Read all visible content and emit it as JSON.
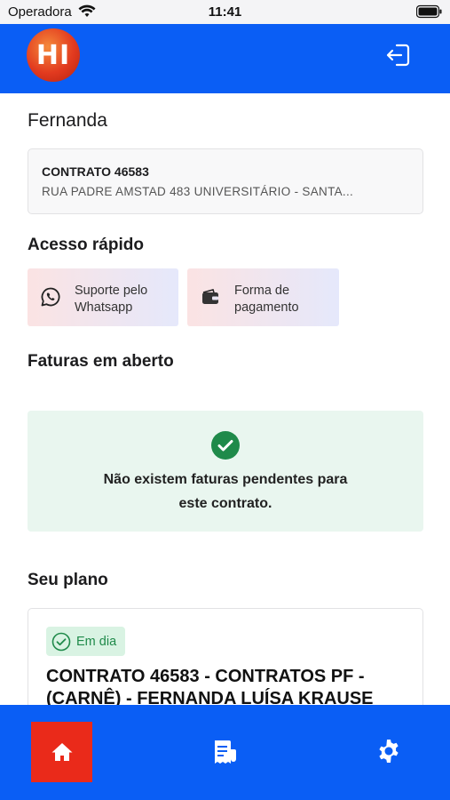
{
  "status_bar": {
    "carrier": "Operadora",
    "time": "11:41"
  },
  "header": {
    "logo_text": "HI",
    "logout_icon": "logout-icon"
  },
  "user": {
    "name": "Fernanda"
  },
  "contract": {
    "title": "CONTRATO 46583",
    "address": "RUA PADRE AMSTAD 483 UNIVERSITÁRIO - SANTA..."
  },
  "quick_access": {
    "title": "Acesso rápido",
    "items": [
      {
        "label": "Suporte pelo Whatsapp",
        "icon": "whatsapp-icon"
      },
      {
        "label": "Forma de pagamento",
        "icon": "wallet-icon"
      }
    ]
  },
  "open_invoices": {
    "title": "Faturas em aberto",
    "empty_line1": "Não existem faturas pendentes para",
    "empty_line2": "este contrato."
  },
  "plan": {
    "title": "Seu plano",
    "badge": "Em dia",
    "name": "CONTRATO 46583 - CONTRATOS PF - (CARNÊ) - FERNANDA LUÍSA KRAUSE"
  },
  "colors": {
    "primary": "#0a5ef5",
    "active_tab": "#ea2a1a",
    "success": "#1f8a4a"
  },
  "bottom_nav": {
    "active": "home",
    "items": [
      "home-icon",
      "invoice-icon",
      "gear-icon"
    ]
  }
}
